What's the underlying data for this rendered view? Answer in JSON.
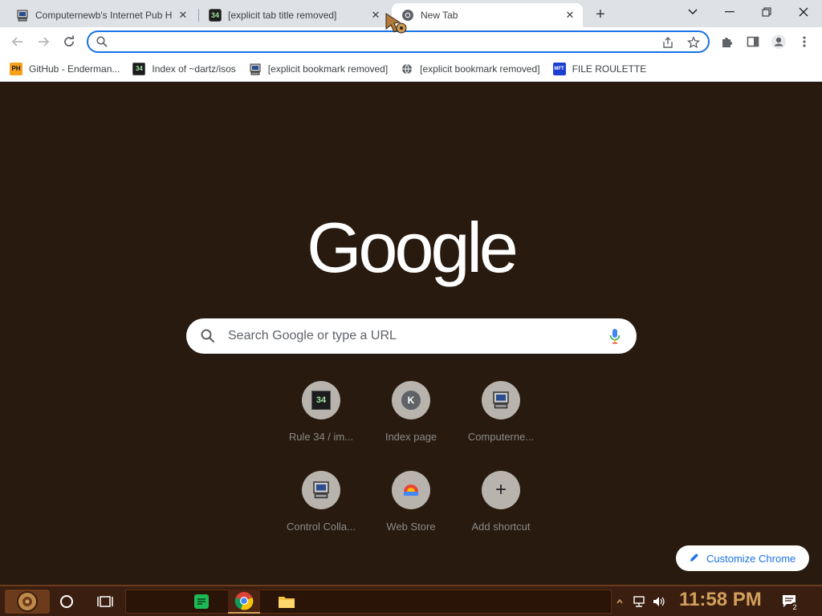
{
  "tabs": [
    {
      "title": "Computernewb's Internet Pub H",
      "favicon": "computer-icon",
      "active": false
    },
    {
      "title": "[explicit tab title removed]",
      "favicon": "34-icon",
      "active": false
    },
    {
      "title": "New Tab",
      "favicon": "chrome-icon",
      "active": true
    }
  ],
  "window": {
    "new_tab_label": "+"
  },
  "omnibox": {
    "value": "",
    "placeholder": ""
  },
  "bookmarks": [
    {
      "label": "GitHub - Enderman...",
      "icon": "ph-icon"
    },
    {
      "label": "Index of ~dartz/isos",
      "icon": "34-icon"
    },
    {
      "label": "[explicit bookmark removed]",
      "icon": "computer-icon"
    },
    {
      "label": "[explicit bookmark removed]",
      "icon": "globe-icon"
    },
    {
      "label": "FILE ROULETTE",
      "icon": "mft-icon"
    }
  ],
  "ntp": {
    "logo": "Google",
    "search_placeholder": "Search Google or type a URL",
    "shortcuts": [
      {
        "label": "Rule 34 / im...",
        "icon": "34-icon"
      },
      {
        "label": "Index page",
        "icon": "letter-k-icon",
        "letter": "K"
      },
      {
        "label": "Computerne...",
        "icon": "computer-icon"
      },
      {
        "label": "Control Colla...",
        "icon": "computer-icon"
      },
      {
        "label": "Web Store",
        "icon": "web-store-icon"
      },
      {
        "label": "Add shortcut",
        "icon": "plus-icon",
        "symbol": "+"
      }
    ],
    "customize_label": "Customize Chrome"
  },
  "taskbar": {
    "clock": "11:58 PM",
    "notification_count": "2"
  },
  "colors": {
    "accent": "#1a73e8",
    "ntp_background": "#281a0e",
    "clock": "#d2a05c"
  }
}
